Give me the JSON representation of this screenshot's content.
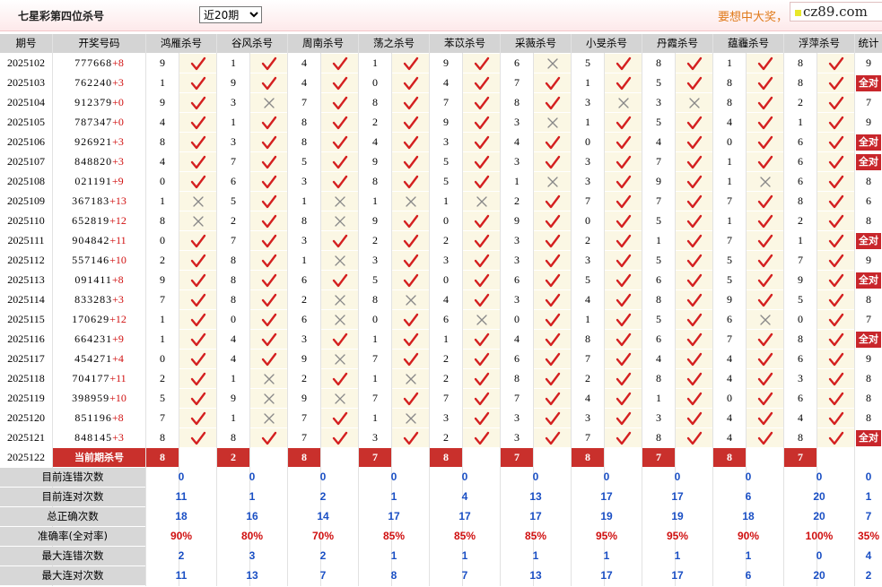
{
  "header": {
    "title": "七星彩第四位杀号",
    "period_select": "近20期",
    "promo_text": "要想中大奖，",
    "logo_text": "cz89.com"
  },
  "table": {
    "col_issue": "期号",
    "col_draw": "开奖号码",
    "col_total": "统计",
    "current_label": "当前期杀号",
    "all_correct_label": "全对",
    "killers": [
      "鸿雁杀号",
      "谷风杀号",
      "周南杀号",
      "荡之杀号",
      "苯苡杀号",
      "采薇杀号",
      "小旻杀号",
      "丹霞杀号",
      "蕴霾杀号",
      "浮萍杀号"
    ],
    "rows": [
      {
        "issue": "2025102",
        "draw": "777668",
        "sum": "+8",
        "picks": [
          "9",
          "1",
          "4",
          "1",
          "9",
          "6",
          "5",
          "8",
          "1",
          "8"
        ],
        "marks": [
          1,
          1,
          1,
          1,
          1,
          0,
          1,
          1,
          1,
          1
        ],
        "total": "9"
      },
      {
        "issue": "2025103",
        "draw": "762240",
        "sum": "+3",
        "picks": [
          "1",
          "9",
          "4",
          "0",
          "4",
          "7",
          "1",
          "5",
          "8",
          "8"
        ],
        "marks": [
          1,
          1,
          1,
          1,
          1,
          1,
          1,
          1,
          1,
          1
        ],
        "total": "全对"
      },
      {
        "issue": "2025104",
        "draw": "912379",
        "sum": "+0",
        "picks": [
          "9",
          "3",
          "7",
          "8",
          "7",
          "8",
          "3",
          "3",
          "8",
          "2"
        ],
        "marks": [
          1,
          0,
          1,
          1,
          1,
          1,
          0,
          0,
          1,
          1
        ],
        "total": "7"
      },
      {
        "issue": "2025105",
        "draw": "787347",
        "sum": "+0",
        "picks": [
          "4",
          "1",
          "8",
          "2",
          "9",
          "3",
          "1",
          "5",
          "4",
          "1"
        ],
        "marks": [
          1,
          1,
          1,
          1,
          1,
          0,
          1,
          1,
          1,
          1
        ],
        "total": "9"
      },
      {
        "issue": "2025106",
        "draw": "926921",
        "sum": "+3",
        "picks": [
          "8",
          "3",
          "8",
          "4",
          "3",
          "4",
          "0",
          "4",
          "0",
          "6"
        ],
        "marks": [
          1,
          1,
          1,
          1,
          1,
          1,
          1,
          1,
          1,
          1
        ],
        "total": "全对"
      },
      {
        "issue": "2025107",
        "draw": "848820",
        "sum": "+3",
        "picks": [
          "4",
          "7",
          "5",
          "9",
          "5",
          "3",
          "3",
          "7",
          "1",
          "6"
        ],
        "marks": [
          1,
          1,
          1,
          1,
          1,
          1,
          1,
          1,
          1,
          1
        ],
        "total": "全对"
      },
      {
        "issue": "2025108",
        "draw": "021191",
        "sum": "+9",
        "picks": [
          "0",
          "6",
          "3",
          "8",
          "5",
          "1",
          "3",
          "9",
          "1",
          "6"
        ],
        "marks": [
          1,
          1,
          1,
          1,
          1,
          0,
          1,
          1,
          0,
          1
        ],
        "total": "8"
      },
      {
        "issue": "2025109",
        "draw": "367183",
        "sum": "+13",
        "picks": [
          "1",
          "5",
          "1",
          "1",
          "1",
          "2",
          "7",
          "7",
          "7",
          "8"
        ],
        "marks": [
          0,
          1,
          0,
          0,
          0,
          1,
          1,
          1,
          1,
          1
        ],
        "total": "6"
      },
      {
        "issue": "2025110",
        "draw": "652819",
        "sum": "+12",
        "picks": [
          "8",
          "2",
          "8",
          "9",
          "0",
          "9",
          "0",
          "5",
          "1",
          "2"
        ],
        "marks": [
          0,
          1,
          0,
          1,
          1,
          1,
          1,
          1,
          1,
          1
        ],
        "total": "8"
      },
      {
        "issue": "2025111",
        "draw": "904842",
        "sum": "+11",
        "picks": [
          "0",
          "7",
          "3",
          "2",
          "2",
          "3",
          "2",
          "1",
          "7",
          "1"
        ],
        "marks": [
          1,
          1,
          1,
          1,
          1,
          1,
          1,
          1,
          1,
          1
        ],
        "total": "全对"
      },
      {
        "issue": "2025112",
        "draw": "557146",
        "sum": "+10",
        "picks": [
          "2",
          "8",
          "1",
          "3",
          "3",
          "3",
          "3",
          "5",
          "5",
          "7"
        ],
        "marks": [
          1,
          1,
          0,
          1,
          1,
          1,
          1,
          1,
          1,
          1
        ],
        "total": "9"
      },
      {
        "issue": "2025113",
        "draw": "091411",
        "sum": "+8",
        "picks": [
          "9",
          "8",
          "6",
          "5",
          "0",
          "6",
          "5",
          "6",
          "5",
          "9"
        ],
        "marks": [
          1,
          1,
          1,
          1,
          1,
          1,
          1,
          1,
          1,
          1
        ],
        "total": "全对"
      },
      {
        "issue": "2025114",
        "draw": "833283",
        "sum": "+3",
        "picks": [
          "7",
          "8",
          "2",
          "8",
          "4",
          "3",
          "4",
          "8",
          "9",
          "5"
        ],
        "marks": [
          1,
          1,
          0,
          0,
          1,
          1,
          1,
          1,
          1,
          1
        ],
        "total": "8"
      },
      {
        "issue": "2025115",
        "draw": "170629",
        "sum": "+12",
        "picks": [
          "1",
          "0",
          "6",
          "0",
          "6",
          "0",
          "1",
          "5",
          "6",
          "0"
        ],
        "marks": [
          1,
          1,
          0,
          1,
          0,
          1,
          1,
          1,
          0,
          1
        ],
        "total": "7"
      },
      {
        "issue": "2025116",
        "draw": "664231",
        "sum": "+9",
        "picks": [
          "1",
          "4",
          "3",
          "1",
          "1",
          "4",
          "8",
          "6",
          "7",
          "8"
        ],
        "marks": [
          1,
          1,
          1,
          1,
          1,
          1,
          1,
          1,
          1,
          1
        ],
        "total": "全对"
      },
      {
        "issue": "2025117",
        "draw": "454271",
        "sum": "+4",
        "picks": [
          "0",
          "4",
          "9",
          "7",
          "2",
          "6",
          "7",
          "4",
          "4",
          "6"
        ],
        "marks": [
          1,
          1,
          0,
          1,
          1,
          1,
          1,
          1,
          1,
          1
        ],
        "total": "9"
      },
      {
        "issue": "2025118",
        "draw": "704177",
        "sum": "+11",
        "picks": [
          "2",
          "1",
          "2",
          "1",
          "2",
          "8",
          "2",
          "8",
          "4",
          "3"
        ],
        "marks": [
          1,
          0,
          1,
          0,
          1,
          1,
          1,
          1,
          1,
          1
        ],
        "total": "8"
      },
      {
        "issue": "2025119",
        "draw": "398959",
        "sum": "+10",
        "picks": [
          "5",
          "9",
          "9",
          "7",
          "7",
          "7",
          "4",
          "1",
          "0",
          "6"
        ],
        "marks": [
          1,
          0,
          0,
          1,
          1,
          1,
          1,
          1,
          1,
          1
        ],
        "total": "8"
      },
      {
        "issue": "2025120",
        "draw": "851196",
        "sum": "+8",
        "picks": [
          "7",
          "1",
          "7",
          "1",
          "3",
          "3",
          "3",
          "3",
          "4",
          "4"
        ],
        "marks": [
          1,
          0,
          1,
          0,
          1,
          1,
          1,
          1,
          1,
          1
        ],
        "total": "8"
      },
      {
        "issue": "2025121",
        "draw": "848145",
        "sum": "+3",
        "picks": [
          "8",
          "8",
          "7",
          "3",
          "2",
          "3",
          "7",
          "8",
          "4",
          "8"
        ],
        "marks": [
          1,
          1,
          1,
          1,
          1,
          1,
          1,
          1,
          1,
          1
        ],
        "total": "全对"
      }
    ],
    "current": {
      "issue": "2025122",
      "picks": [
        "8",
        "2",
        "8",
        "7",
        "8",
        "7",
        "8",
        "7",
        "8",
        "7"
      ]
    }
  },
  "stats": [
    {
      "label": "目前连错次数",
      "values": [
        "0",
        "0",
        "0",
        "0",
        "0",
        "0",
        "0",
        "0",
        "0",
        "0",
        "0"
      ]
    },
    {
      "label": "目前连对次数",
      "values": [
        "11",
        "1",
        "2",
        "1",
        "4",
        "13",
        "17",
        "17",
        "6",
        "20",
        "1"
      ]
    },
    {
      "label": "总正确次数",
      "values": [
        "18",
        "16",
        "14",
        "17",
        "17",
        "17",
        "19",
        "19",
        "18",
        "20",
        "7"
      ]
    },
    {
      "label": "准确率(全对率)",
      "values": [
        "90%",
        "80%",
        "70%",
        "85%",
        "85%",
        "85%",
        "95%",
        "95%",
        "90%",
        "100%",
        "35%"
      ],
      "is_rate": true
    },
    {
      "label": "最大连错次数",
      "values": [
        "2",
        "3",
        "2",
        "1",
        "1",
        "1",
        "1",
        "1",
        "1",
        "0",
        "4"
      ]
    },
    {
      "label": "最大连对次数",
      "values": [
        "11",
        "13",
        "7",
        "8",
        "7",
        "13",
        "17",
        "17",
        "6",
        "20",
        "2"
      ]
    }
  ],
  "colors": {
    "check": "#d42020",
    "cross": "#888888",
    "current_bg": "#c9302c",
    "rate": "#d01010",
    "stat_value": "#1a4fc4",
    "promo": "#e07b1c"
  }
}
